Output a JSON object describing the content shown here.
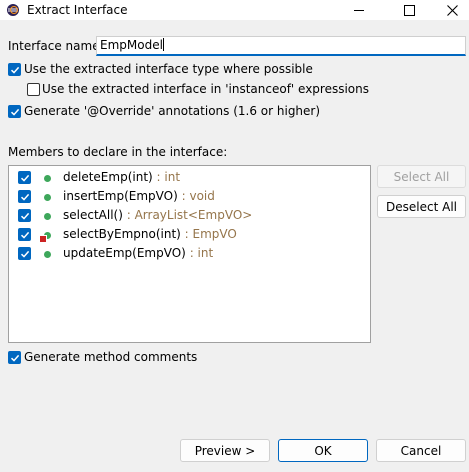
{
  "window": {
    "title": "Extract Interface",
    "icon": "eclipse-app-icon"
  },
  "form": {
    "interface_name_label": "Interface name:",
    "interface_name_value": "EmpModel",
    "use_extracted_type_label": "Use the extracted interface type where possible",
    "use_extracted_type_checked": true,
    "instanceof_label": "Use the extracted interface in 'instanceof' expressions",
    "instanceof_checked": false,
    "override_label": "Generate '@Override' annotations (1.6 or higher)",
    "override_checked": true,
    "members_label": "Members to declare in the interface:",
    "generate_comments_label": "Generate method comments",
    "generate_comments_checked": true
  },
  "members": [
    {
      "name": "deleteEmp(int)",
      "return_type": " : int",
      "checked": true,
      "icon": "public-method-icon",
      "error": false
    },
    {
      "name": "insertEmp(EmpVO)",
      "return_type": " : void",
      "checked": true,
      "icon": "public-method-icon",
      "error": false
    },
    {
      "name": "selectAll()",
      "return_type": " : ArrayList<EmpVO>",
      "checked": true,
      "icon": "public-method-icon",
      "error": false
    },
    {
      "name": "selectByEmpno(int)",
      "return_type": " : EmpVO",
      "checked": true,
      "icon": "public-method-icon",
      "error": true
    },
    {
      "name": "updateEmp(EmpVO)",
      "return_type": " : int",
      "checked": true,
      "icon": "public-method-icon",
      "error": false
    }
  ],
  "buttons": {
    "select_all": "Select All",
    "select_all_enabled": false,
    "deselect_all": "Deselect All",
    "preview": "Preview >",
    "ok": "OK",
    "cancel": "Cancel"
  },
  "colors": {
    "accent": "#0067c0",
    "method_dot": "#3ea75b",
    "return_type": "#95754b",
    "error_marker": "#cc2222"
  }
}
